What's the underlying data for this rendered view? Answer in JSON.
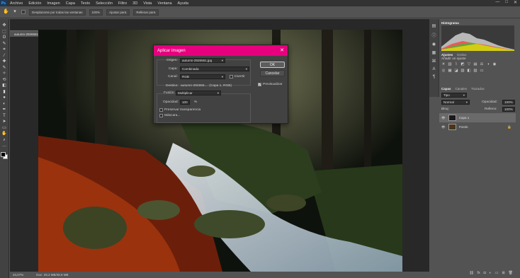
{
  "menubar": {
    "logo": "Ps",
    "items": [
      "Archivo",
      "Edición",
      "Imagen",
      "Capa",
      "Texto",
      "Selección",
      "Filtro",
      "3D",
      "Vista",
      "Ventana",
      "Ayuda"
    ],
    "window_controls": [
      "—",
      "□",
      "✕"
    ]
  },
  "options_bar": {
    "align_label": "Desplazarse por todas las ventanas",
    "zoom_value": "100%",
    "fit_screen": "Ajustar pant.",
    "fill_screen": "Rellenar pant."
  },
  "document": {
    "tab_label": "autumn-2926561.jpg al 34,1% (Capa 1, RGB/8#) *",
    "zoom": "34,07%",
    "doc_info": "Doc: 29,3 MB/48,9 MB"
  },
  "dialog": {
    "title": "Aplicar imagen",
    "source_label": "Origen:",
    "source_value": "autumn-2926561.jpg",
    "layer_label": "Capa:",
    "layer_value": "Combinada",
    "channel_label": "Canal:",
    "channel_value": "RGB",
    "invert_label": "Invertir",
    "target_label": "Destino:",
    "target_value": "autumn-292656.... (Capa 1, RGB)",
    "blending_label": "Fusión:",
    "blending_value": "Multiplicar",
    "opacity_label": "Opacidad:",
    "opacity_value": "100",
    "opacity_unit": "%",
    "preserve_label": "Preservar transparencia",
    "mask_label": "Máscara...",
    "ok_label": "OK",
    "cancel_label": "Cancelar",
    "preview_label": "Previsualizar",
    "preview_checked": true,
    "accent_color": "#e6007e"
  },
  "panels": {
    "histogram_tab": "Histograma",
    "adjust_tabs": [
      "Ajustes",
      "Estilos"
    ],
    "adjust_hint": "Añadir un ajuste",
    "layers_tabs": [
      "Capas",
      "Canales",
      "Trazados"
    ],
    "layer_search": "Tipo",
    "layer_blend": "Normal",
    "opacity_label": "Opacidad:",
    "opacity_value": "100%",
    "lock_label": "Bloq:",
    "fill_label": "Relleno:",
    "fill_value": "100%",
    "layers": [
      {
        "name": "Capa 1",
        "selected": true
      },
      {
        "name": "Fondo",
        "selected": false
      }
    ]
  },
  "tools": {
    "icons": [
      "move-icon",
      "marquee-icon",
      "lasso-icon",
      "quick-select-icon",
      "crop-icon",
      "eyedropper-icon",
      "healing-icon",
      "brush-icon",
      "stamp-icon",
      "history-brush-icon",
      "eraser-icon",
      "gradient-icon",
      "blur-icon",
      "dodge-icon",
      "pen-icon",
      "text-icon",
      "path-select-icon",
      "shape-icon",
      "hand-icon",
      "zoom-icon",
      "more-icon"
    ],
    "glyphs": [
      "✥",
      "⬚",
      "ʘ",
      "✎",
      "⌗",
      "⁄",
      "✚",
      "✎",
      "✧",
      "⟲",
      "◧",
      "▮",
      "●",
      "◐",
      "✒",
      "T",
      "➤",
      "▭",
      "✋",
      "⌕",
      "…"
    ]
  }
}
